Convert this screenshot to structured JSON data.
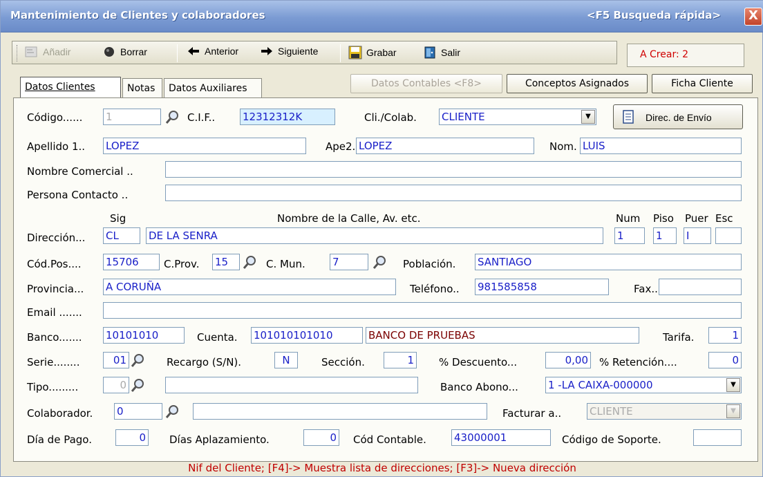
{
  "window": {
    "title": "Mantenimiento de Clientes y colaboradores",
    "quick_search": "<F5 Busqueda rápida>",
    "close": "X"
  },
  "toolbar": {
    "add": "Añadir",
    "delete": "Borrar",
    "prev": "Anterior",
    "next": "Siguiente",
    "save": "Grabar",
    "exit": "Salir"
  },
  "status": "A Crear: 2",
  "tabs": [
    "Datos Clientes",
    "Notas",
    "Datos Auxiliares"
  ],
  "header_buttons": {
    "accounting": "Datos Contables <F8>",
    "concepts": "Conceptos Asignados",
    "card": "Ficha Cliente"
  },
  "form": {
    "codigo_label": "Código......",
    "codigo": "1",
    "cif_label": "C.I.F..",
    "cif": "12312312K",
    "clicolab_label": "Cli./Colab.",
    "clicolab": "CLIENTE",
    "envio_btn": "Direc. de Envío",
    "apellido1_label": "Apellido 1..",
    "apellido1": "LOPEZ",
    "ape2_label": "Ape2.",
    "ape2": "LOPEZ",
    "nom_label": "Nom.",
    "nom": "LUIS",
    "nombre_comercial_label": "Nombre Comercial ..",
    "nombre_comercial": "",
    "persona_contacto_label": "Persona Contacto ..",
    "persona_contacto": "",
    "sig_header": "Sig",
    "calle_header": "Nombre de la Calle, Av. etc.",
    "num_header": "Num",
    "piso_header": "Piso",
    "puer_header": "Puer",
    "esc_header": "Esc",
    "direccion_label": "Dirección...",
    "sig": "CL",
    "calle": "DE LA SENRA",
    "num": "1",
    "piso": "1",
    "puer": "I",
    "esc": "",
    "codpos_label": "Cód.Pos....",
    "codpos": "15706",
    "cprov_label": "C.Prov.",
    "cprov": "15",
    "cmun_label": "C. Mun.",
    "cmun": "7",
    "poblacion_label": "Población.",
    "poblacion": "SANTIAGO",
    "provincia_label": "Provincia...",
    "provincia": "A CORUÑA",
    "telefono_label": "Teléfono..",
    "telefono": "981585858",
    "fax_label": "Fax..",
    "fax": "",
    "email_label": "Email .......",
    "email": "",
    "banco_label": "Banco.......",
    "banco": "10101010",
    "cuenta_label": "Cuenta.",
    "cuenta": "101010101010",
    "banco_nombre": "BANCO DE PRUEBAS",
    "tarifa_label": "Tarifa.",
    "tarifa": "1",
    "serie_label": "Serie........",
    "serie": "01",
    "recargo_label": "Recargo (S/N).",
    "recargo": "N",
    "seccion_label": "Sección.",
    "seccion": "1",
    "descuento_label": "% Descuento...",
    "descuento": "0,00",
    "retencion_label": "% Retención....",
    "retencion": "0",
    "tipo_label": "Tipo.........",
    "tipo": "0",
    "tipo_desc": "",
    "banco_abono_label": "Banco Abono...",
    "banco_abono": "1 -LA CAIXA-000000",
    "colaborador_label": "Colaborador.",
    "colaborador": "0",
    "colaborador_desc": "",
    "facturar_label": "Facturar a..",
    "facturar": "CLIENTE",
    "dia_pago_label": "Día de Pago.",
    "dia_pago": "0",
    "dias_aplaz_label": "Días Aplazamiento.",
    "dias_aplaz": "0",
    "cod_contable_label": "Cód Contable.",
    "cod_contable": "43000001",
    "cod_soporte_label": "Código de Soporte.",
    "cod_soporte": ""
  },
  "hint": "Nif del Cliente; [F4]-> Muestra lista de direcciones; [F3]-> Nueva dirección"
}
